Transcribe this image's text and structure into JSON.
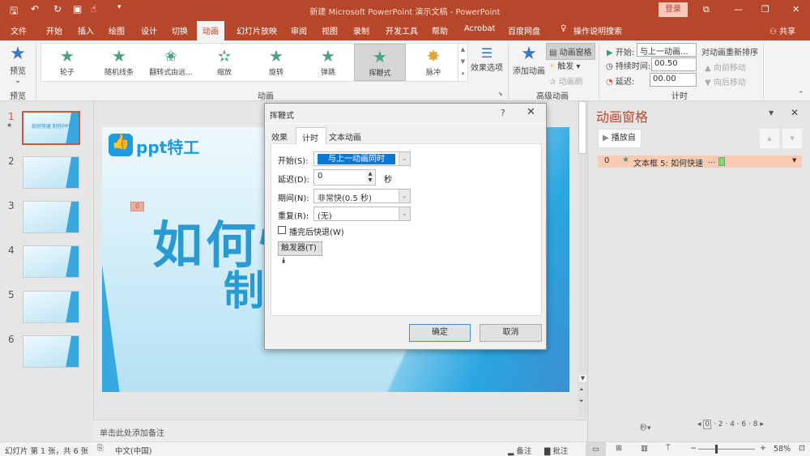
{
  "window": {
    "title": "新建 Microsoft PowerPoint 演示文稿 - PowerPoint",
    "login": "登录",
    "brand_color": "#b7472a"
  },
  "quick_access": [
    "save-icon",
    "undo-icon",
    "redo-icon",
    "present-icon",
    "touch-icon",
    "customize-icon"
  ],
  "tabs": [
    "文件",
    "开始",
    "插入",
    "绘图",
    "设计",
    "切换",
    "动画",
    "幻灯片放映",
    "审阅",
    "视图",
    "录制",
    "开发工具",
    "帮助",
    "Acrobat",
    "百度网盘",
    "操作说明搜索"
  ],
  "share": "共享",
  "ribbon": {
    "preview": {
      "label": "预览",
      "group": "预览"
    },
    "animations": [
      "轮子",
      "随机线条",
      "翻转式由远...",
      "缩放",
      "旋转",
      "弹跳",
      "挥鞭式",
      "脉冲"
    ],
    "effect_options": "效果选项",
    "group_animation": "动画",
    "add_animation": "添加动画",
    "animation_pane": "动画窗格",
    "trigger": "触发",
    "painter": "动画刷",
    "group_advanced": "高级动画",
    "start_label": "开始:",
    "start_value": "与上一动画...",
    "duration_label": "持续时间:",
    "duration_value": "00.50",
    "delay_label": "延迟:",
    "delay_value": "00.00",
    "group_timing": "计时",
    "reorder": "对动画重新排序",
    "move_earlier": "向前移动",
    "move_later": "向后移动"
  },
  "slides": {
    "numbers": [
      "1",
      "2",
      "3",
      "4",
      "5",
      "6"
    ],
    "thumb_title": "如何快速 制作PPT"
  },
  "slide": {
    "logo": "ppt特工",
    "title_line1": "如何快速",
    "title_line2": "制作PPT",
    "anim_tag": "0"
  },
  "notes_placeholder": "单击此处添加备注",
  "pane": {
    "title": "动画窗格",
    "play": "播放自",
    "item_index": "0",
    "item_label": "文本框 5: 如何快速",
    "item_suffix": "...",
    "seconds": "秒▾",
    "timeline": [
      "0",
      "2",
      "4",
      "6",
      "8"
    ]
  },
  "dialog": {
    "title": "挥鞭式",
    "help": "?",
    "tabs": [
      "效果",
      "计时",
      "文本动画"
    ],
    "start_label": "开始(S):",
    "start_value": "与上一动画同时",
    "delay_label": "延迟(D):",
    "delay_value": "0",
    "delay_unit": "秒",
    "period_label": "期间(N):",
    "period_value": "非常快(0.5 秒)",
    "repeat_label": "重复(R):",
    "repeat_value": "(无)",
    "rewind_label": "播完后快退(W)",
    "rewind_checked": false,
    "trigger": "触发器(T)",
    "ok": "确定",
    "cancel": "取消"
  },
  "status": {
    "slide_info": "幻灯片 第 1 张，共 6 张",
    "language": "中文(中国)",
    "notes": "备注",
    "comments": "批注",
    "zoom": "58%",
    "zoom_fraction": 0.3
  }
}
